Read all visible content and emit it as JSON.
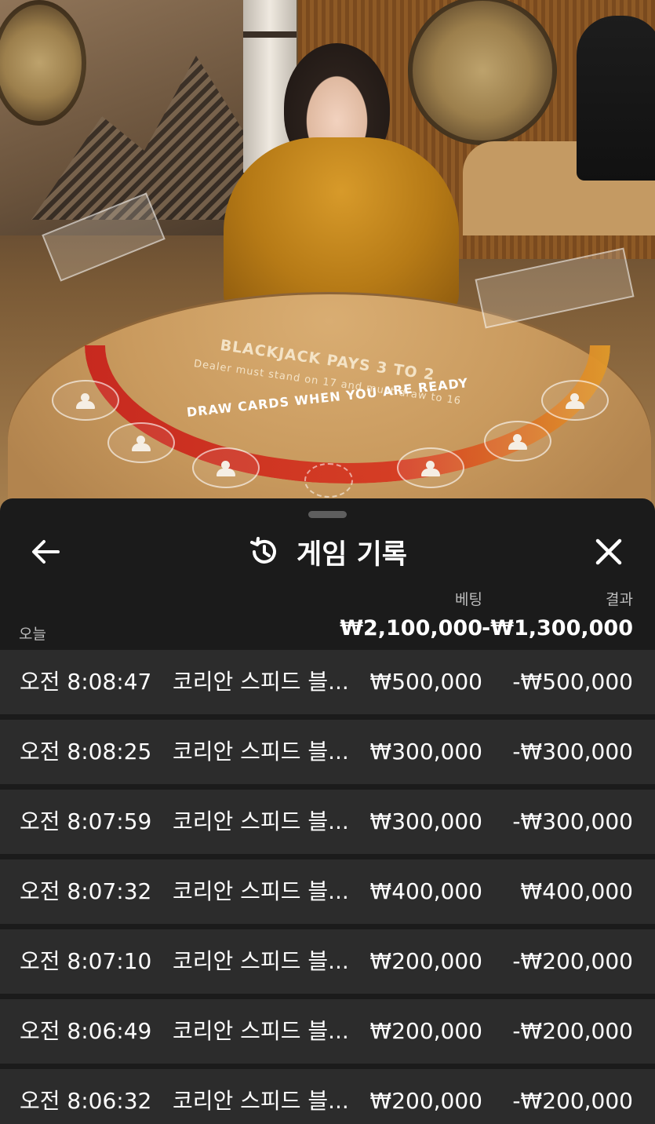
{
  "scene": {
    "felt_line1": "BLACKJACK PAYS 3 TO 2",
    "felt_line2": "Dealer must stand on 17 and must draw to 16",
    "felt_line3": "DRAW CARDS WHEN YOU ARE READY"
  },
  "panel": {
    "title": "게임 기록",
    "col_bet": "베팅",
    "col_result": "결과",
    "today_label": "오늘",
    "total_bet": "₩2,100,000",
    "total_result": "-₩1,300,000",
    "rows": [
      {
        "time": "오전 8:08:47",
        "game": "코리안 스피드 블...",
        "bet": "₩500,000",
        "result": "-₩500,000"
      },
      {
        "time": "오전 8:08:25",
        "game": "코리안 스피드 블...",
        "bet": "₩300,000",
        "result": "-₩300,000"
      },
      {
        "time": "오전 8:07:59",
        "game": "코리안 스피드 블...",
        "bet": "₩300,000",
        "result": "-₩300,000"
      },
      {
        "time": "오전 8:07:32",
        "game": "코리안 스피드 블...",
        "bet": "₩400,000",
        "result": "₩400,000"
      },
      {
        "time": "오전 8:07:10",
        "game": "코리안 스피드 블...",
        "bet": "₩200,000",
        "result": "-₩200,000"
      },
      {
        "time": "오전 8:06:49",
        "game": "코리안 스피드 블...",
        "bet": "₩200,000",
        "result": "-₩200,000"
      },
      {
        "time": "오전 8:06:32",
        "game": "코리안 스피드 블...",
        "bet": "₩200,000",
        "result": "-₩200,000"
      }
    ]
  },
  "icons": {
    "back": "arrow-left-icon",
    "history": "history-clock-icon",
    "close": "close-icon"
  },
  "colors": {
    "panel_bg": "#1b1b1b",
    "row_bg": "#2c2c2c",
    "text": "#ffffff",
    "muted": "#bdbdbd"
  }
}
